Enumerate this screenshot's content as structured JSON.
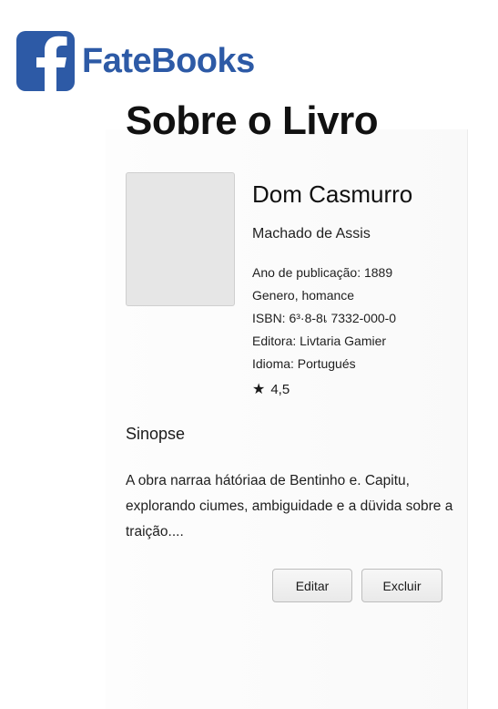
{
  "brand": {
    "name": "FateBooks",
    "icon": "facebook-f-icon",
    "color": "#2d5aa6"
  },
  "page": {
    "title": "Sobre o Livro"
  },
  "book": {
    "title": "Dom Casmurro",
    "author": "Machado de Assis",
    "meta": [
      "Ano de publicação: 1889",
      "Genero, homance",
      "ISBN: 6³·8-8เ 7332-000-0",
      "Editora: Livtaria Gamier",
      "Idioma: Portugués"
    ],
    "rating_icon": "star-icon",
    "rating": "4,5"
  },
  "synopsis": {
    "title": "Sinopse",
    "text": "A obra narraa hátóriaa de Bentinho e. Capitu, explorando ciumes, ambiguidade e a düvida sobre a traição...."
  },
  "actions": {
    "edit_label": "Editar",
    "delete_label": "Excluir"
  }
}
